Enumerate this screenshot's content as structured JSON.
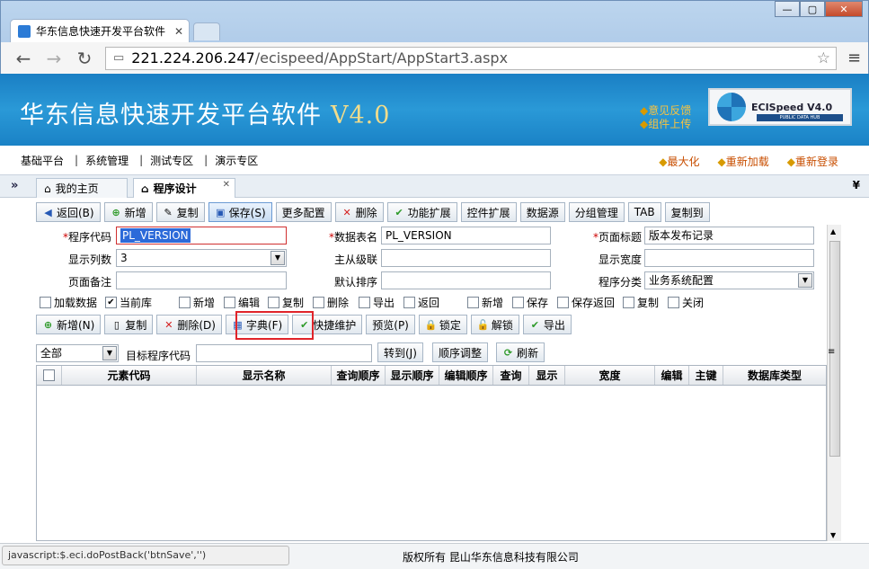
{
  "browser": {
    "tab_title": "华东信息快速开发平台软件",
    "url_host": "221.224.206.247",
    "url_path": "/ecispeed/AppStart/AppStart3.aspx",
    "win_min": "—",
    "win_max": "▢",
    "win_close": "✕"
  },
  "banner": {
    "title": "华东信息快速开发平台软件",
    "version": "V4.0",
    "feedback": "意见反馈",
    "upload": "组件上传",
    "logo_text": "ECISpeed V4.0",
    "logo_sub": "PUBLIC DATA HUB"
  },
  "mainnav": {
    "items": [
      "基础平台",
      "系统管理",
      "测试专区",
      "演示专区"
    ],
    "right": [
      "最大化",
      "重新加载",
      "重新登录"
    ]
  },
  "tabs": {
    "home": "我的主页",
    "design": "程序设计"
  },
  "bar1": [
    "返回(B)",
    "新增",
    "复制",
    "保存(S)",
    "更多配置",
    "删除",
    "功能扩展",
    "控件扩展",
    "数据源",
    "分组管理",
    "TAB",
    "复制到"
  ],
  "form": {
    "row1": {
      "l1": "程序代码",
      "v1": "PL_VERSION",
      "l2": "数据表名",
      "v2": "PL_VERSION",
      "l3": "页面标题",
      "v3": "版本发布记录"
    },
    "row2": {
      "l1": "显示列数",
      "v1": "3",
      "l2": "主从级联",
      "l3": "显示宽度"
    },
    "row3": {
      "l1": "页面备注",
      "l2": "默认排序",
      "l3": "程序分类",
      "v3": "业务系统配置"
    }
  },
  "checkboxes": [
    "加载数据",
    "当前库",
    "新增",
    "编辑",
    "复制",
    "删除",
    "导出",
    "返回",
    "新增",
    "保存",
    "保存返回",
    "复制",
    "关闭"
  ],
  "bar2": [
    "新增(N)",
    "复制",
    "删除(D)",
    "字典(F)",
    "快捷维护",
    "预览(P)",
    "锁定",
    "解锁",
    "导出"
  ],
  "filter": {
    "scope": "全部",
    "target_label": "目标程序代码",
    "goto": "转到(J)",
    "order": "顺序调整",
    "refresh": "刷新"
  },
  "grid": {
    "headers": [
      "元素代码",
      "显示名称",
      "查询顺序",
      "显示顺序",
      "编辑顺序",
      "查询",
      "显示",
      "宽度",
      "编辑",
      "主键",
      "数据库类型"
    ]
  },
  "footer": {
    "status": "javascript:$.eci.doPostBack('btnSave','')",
    "copyright": "版权所有 昆山华东信息科技有限公司"
  }
}
